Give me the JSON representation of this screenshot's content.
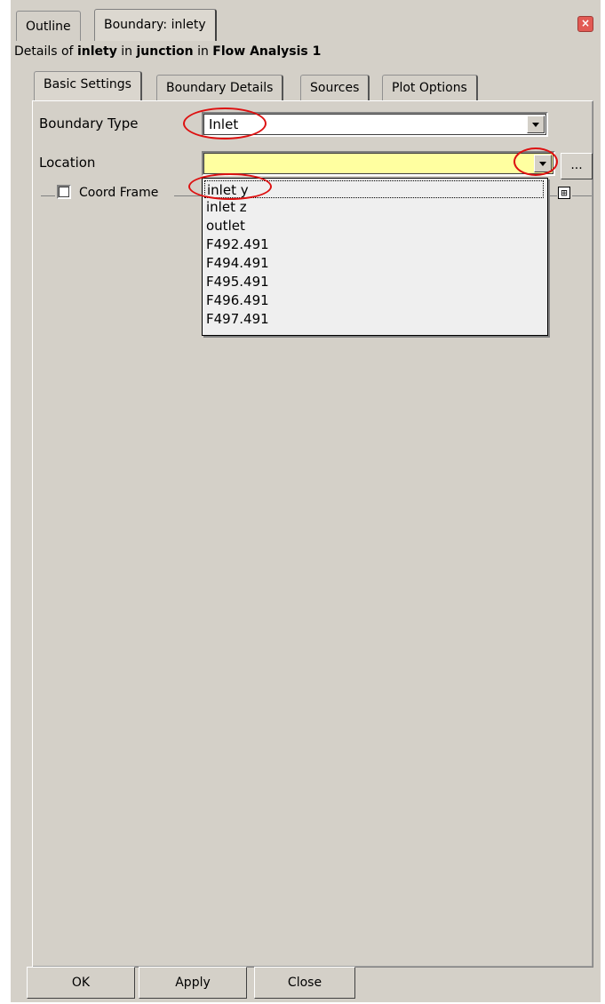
{
  "top_tabs": {
    "outline": "Outline",
    "boundary": "Boundary: inlety"
  },
  "details": {
    "prefix": "Details of",
    "object": "inlety",
    "in1": "in",
    "domain": "junction",
    "in2": "in",
    "analysis": "Flow Analysis 1"
  },
  "inner_tabs": [
    "Basic Settings",
    "Boundary Details",
    "Sources",
    "Plot Options"
  ],
  "boundary_type": {
    "label": "Boundary Type",
    "value": "Inlet"
  },
  "location": {
    "label": "Location",
    "value": "",
    "browse_label": "..."
  },
  "coord_frame": {
    "label": "Coord Frame",
    "expand_symbol": "⊞"
  },
  "location_options": [
    "inlet y",
    "inlet z",
    "outlet",
    "F492.491",
    "F494.491",
    "F495.491",
    "F496.491",
    "F497.491"
  ],
  "buttons": {
    "ok": "OK",
    "apply": "Apply",
    "close": "Close"
  },
  "colors": {
    "panel_bg": "#d4d0c8",
    "location_field_bg": "#ffffa0",
    "annotation_red": "#dd1111"
  }
}
